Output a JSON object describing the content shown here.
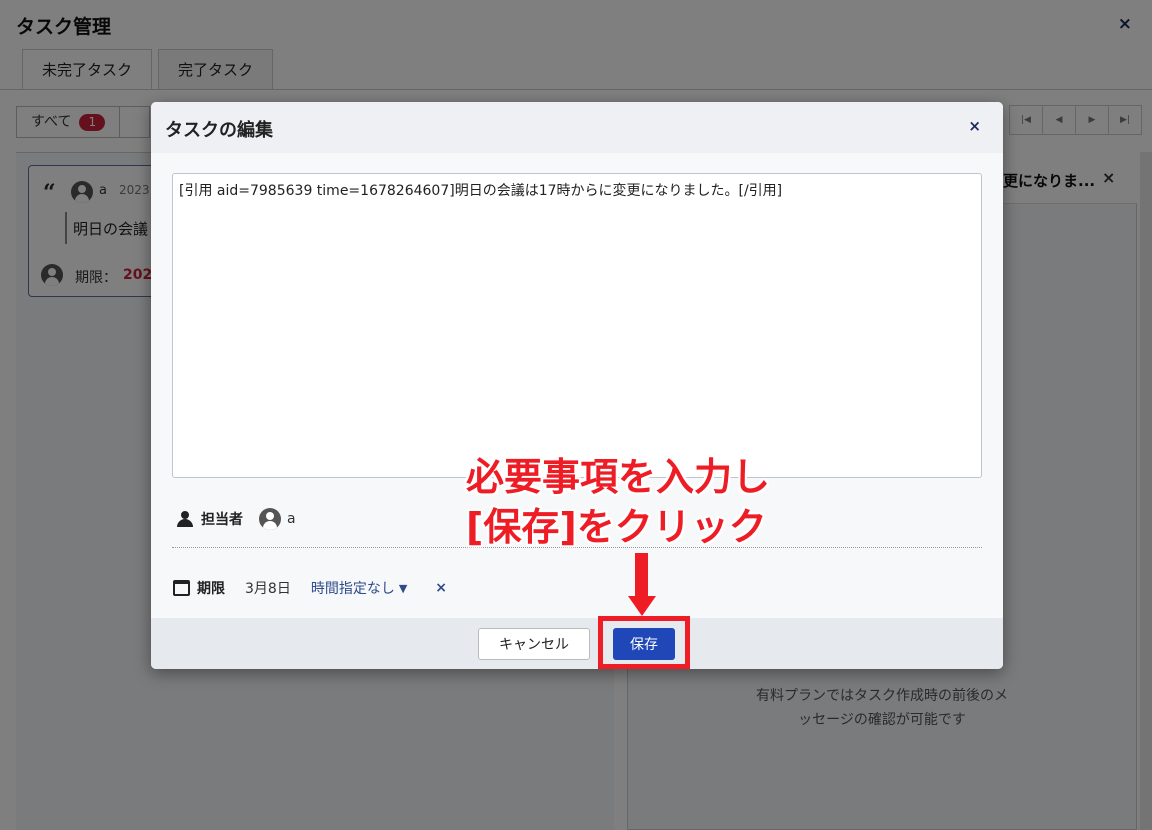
{
  "app": {
    "title": "タスク管理",
    "close_icon": "×",
    "tabs": [
      {
        "label": "未完了タスク"
      },
      {
        "label": "完了タスク"
      }
    ],
    "filter": {
      "all_label": "すべて",
      "all_count": "1"
    },
    "task_card": {
      "user": "a",
      "date_partial": "2023",
      "text_partial": "明日の会議",
      "due_label": "期限：",
      "due_value_partial": "202"
    },
    "right_panel": {
      "header_text": "更になりま...",
      "close_icon": "×",
      "note_line1": "有料プランではタスク作成時の前後のメ",
      "note_line2": "ッセージの確認が可能です"
    }
  },
  "modal": {
    "title": "タスクの編集",
    "close_icon": "×",
    "body_text": "[引用 aid=7985639 time=1678264607]明日の会議は17時からに変更になりました。[/引用]",
    "assignee_label": "担当者",
    "assignee_name": "a",
    "due_label": "期限",
    "due_date": "3月8日",
    "due_time": "時間指定なし",
    "due_time_caret": "▼",
    "due_clear": "×",
    "cancel_label": "キャンセル",
    "save_label": "保存"
  },
  "annotation": {
    "line1": "必要事項を入力し",
    "line2": "[保存]をクリック",
    "color": "#ee1c25"
  }
}
